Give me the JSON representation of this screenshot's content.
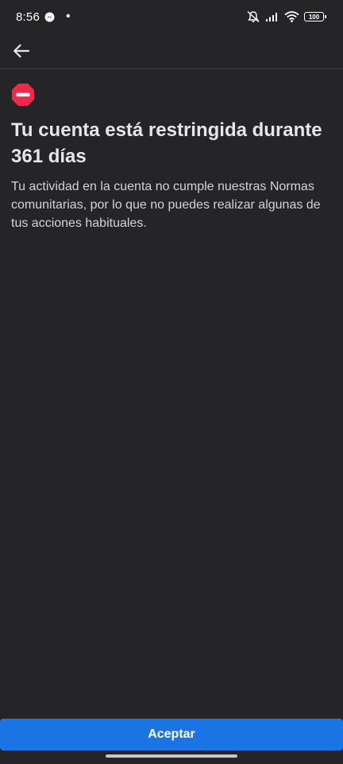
{
  "status_bar": {
    "time": "8:56",
    "dot": "•",
    "battery": "100",
    "icons": [
      "messenger-icon",
      "mute-icon",
      "signal-icon",
      "wifi-icon",
      "battery-icon"
    ]
  },
  "app_bar": {
    "back_icon": "arrow-left-icon"
  },
  "content": {
    "icon": "restricted-icon",
    "title": "Tu cuenta está restringida durante 361 días",
    "description": "Tu actividad en la cuenta no cumple nuestras Normas comunitarias, por lo que no puedes realizar algunas de tus acciones habituales."
  },
  "footer": {
    "accept_label": "Aceptar"
  },
  "colors": {
    "background": "#252527",
    "accent": "#1b74e4",
    "danger": "#f02849",
    "text": "#e4e6eb"
  }
}
